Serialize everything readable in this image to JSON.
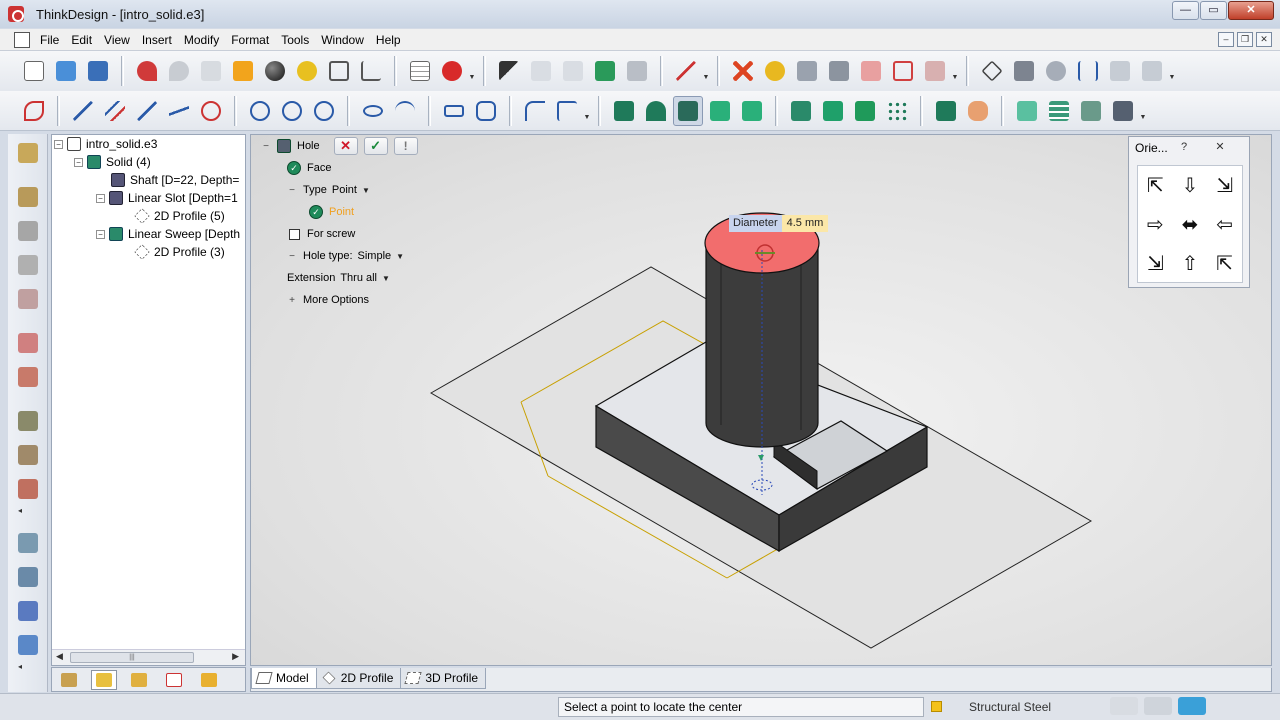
{
  "window": {
    "title": "ThinkDesign - [intro_solid.e3]",
    "buttons": [
      "—",
      "▭",
      "✕"
    ]
  },
  "menu": {
    "items": [
      "File",
      "Edit",
      "View",
      "Insert",
      "Modify",
      "Format",
      "Tools",
      "Window",
      "Help"
    ],
    "mdi_buttons": [
      "–",
      "❐",
      "✕"
    ]
  },
  "tree": {
    "items": [
      {
        "label": "intro_solid.e3",
        "expander": "−",
        "icon": "document-icon"
      },
      {
        "label": "Solid (4)",
        "expander": "−",
        "icon": "solid-icon"
      },
      {
        "label": "Shaft [D=22, Depth=",
        "expander": "",
        "icon": "shaft-feature-icon"
      },
      {
        "label": "Linear Slot [Depth=1",
        "expander": "−",
        "icon": "slot-feature-icon"
      },
      {
        "label": "2D Profile (5)",
        "expander": "",
        "icon": "profile-icon"
      },
      {
        "label": "Linear Sweep [Depth",
        "expander": "−",
        "icon": "sweep-feature-icon"
      },
      {
        "label": "2D Profile (3)",
        "expander": "",
        "icon": "profile-icon"
      }
    ],
    "scroll_thumb_grip": "|||"
  },
  "command_panel": {
    "title": "Hole",
    "face_label": "Face",
    "type_label": "Type",
    "type_value": "Point",
    "point_label": "Point",
    "for_screw_label": "For screw",
    "hole_type_label": "Hole type:",
    "hole_type_value": "Simple",
    "extension_label": "Extension",
    "extension_value": "Thru all",
    "more_options_label": "More Options"
  },
  "dimension_tip": {
    "label": "Diameter",
    "value": "4.5 mm"
  },
  "orientation_panel": {
    "title": "Orie...",
    "help": "?",
    "close": "✕",
    "arrows": [
      "⇱",
      "⇩",
      "⇲",
      "⇨",
      "⬌",
      "⇦",
      "⇲",
      "⇧",
      "⇱"
    ]
  },
  "view_tabs": [
    {
      "label": "Model",
      "active": true
    },
    {
      "label": "2D Profile",
      "active": false
    },
    {
      "label": "3D Profile",
      "active": false
    }
  ],
  "status": {
    "message": "Select a point to locate the center",
    "material": "Structural Steel",
    "material_color": "#f4c21a"
  },
  "colors": {
    "top_face_highlight": "#f26d6d",
    "solid_side": "#3a3a3a",
    "dimension_lines": "#c8a000",
    "confirm_green": "#1a8a3a",
    "cancel_red": "#d0182a"
  }
}
